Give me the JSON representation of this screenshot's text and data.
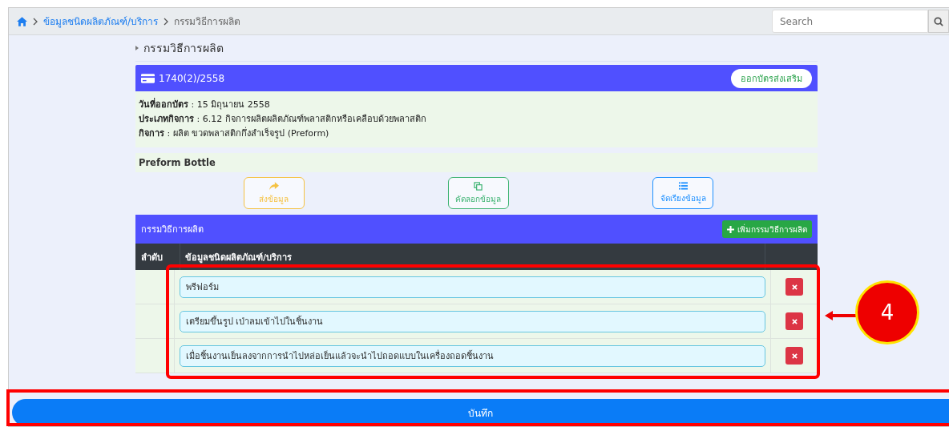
{
  "breadcrumb": {
    "link": "ข้อมูลชนิดผลิตภัณฑ์/บริการ",
    "current": "กรรมวิธีการผลิต"
  },
  "search": {
    "placeholder": "Search"
  },
  "section_title": "กรรมวิธีการผลิต",
  "card": {
    "number": "1740(2)/2558",
    "action": "ออกบัตรส่งเสริม",
    "details": [
      "**วันที่ออกบัตร** : 15 มิถุนายน 2558",
      "**ประเภทกิจการ** : 6.12 กิจการผลิตผลิตภัณฑ์พลาสติกหรือเคลือบด้วยพลาสติก",
      "**กิจการ** : ผลิต ขวดพลาสติกกึ่งสำเร็จรูป (Preform)"
    ]
  },
  "product": "Preform Bottle",
  "actions": [
    {
      "label": "ส่งข้อมูล",
      "kind": "send"
    },
    {
      "label": "คัดลอกข้อมูล",
      "kind": "copy"
    },
    {
      "label": "จัดเรียงข้อมูล",
      "kind": "sort"
    }
  ],
  "process_table": {
    "title": "กรรมวิธีการผลิต",
    "add_button": "เพิ่มกรรมวิธีการผลิต",
    "columns": [
      "ลำดับ",
      "ข้อมูลชนิดผลิตภัณฑ์/บริการ"
    ],
    "highlighted": true,
    "rows": [
      {
        "value": "พรีฟอร์ม"
      },
      {
        "value": "เตรียมขึ้นรูป เป่าลมเข้าไปในชิ้นงาน"
      },
      {
        "value": "เมื่อชิ้นงานเย็นลงจากการนำไปหล่อเย็นแล้วจะนำไปถอดแบบในเครื่องถอดชิ้นงาน"
      }
    ]
  },
  "callout": {
    "label": "4"
  },
  "save_button": {
    "label": "บันทึก",
    "highlighted": true
  }
}
